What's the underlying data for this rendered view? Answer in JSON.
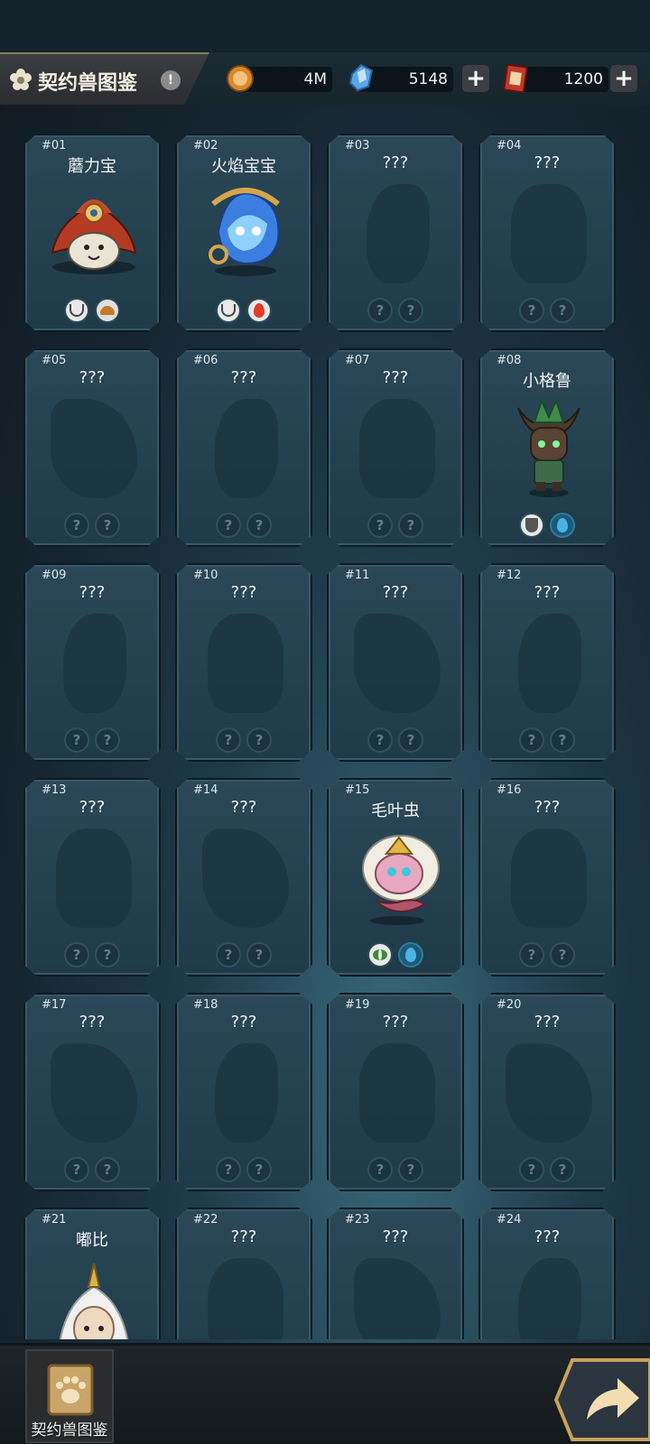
{
  "header": {
    "title": "契约兽图鉴",
    "info": "!",
    "currencies": [
      {
        "name": "coin-icon",
        "value": "4M",
        "plus": false
      },
      {
        "name": "crystal-icon",
        "value": "5148",
        "plus": true
      },
      {
        "name": "ticket-icon",
        "value": "1200",
        "plus": true
      }
    ],
    "plus_label": "+"
  },
  "cards": [
    {
      "num": "#01",
      "name": "蘑力宝",
      "known": true
    },
    {
      "num": "#02",
      "name": "火焰宝宝",
      "known": true
    },
    {
      "num": "#03",
      "name": "???",
      "known": false
    },
    {
      "num": "#04",
      "name": "???",
      "known": false
    },
    {
      "num": "#05",
      "name": "???",
      "known": false
    },
    {
      "num": "#06",
      "name": "???",
      "known": false
    },
    {
      "num": "#07",
      "name": "???",
      "known": false
    },
    {
      "num": "#08",
      "name": "小格鲁",
      "known": true
    },
    {
      "num": "#09",
      "name": "???",
      "known": false
    },
    {
      "num": "#10",
      "name": "???",
      "known": false
    },
    {
      "num": "#11",
      "name": "???",
      "known": false
    },
    {
      "num": "#12",
      "name": "???",
      "known": false
    },
    {
      "num": "#13",
      "name": "???",
      "known": false
    },
    {
      "num": "#14",
      "name": "???",
      "known": false
    },
    {
      "num": "#15",
      "name": "毛叶虫",
      "known": true
    },
    {
      "num": "#16",
      "name": "???",
      "known": false
    },
    {
      "num": "#17",
      "name": "???",
      "known": false
    },
    {
      "num": "#18",
      "name": "???",
      "known": false
    },
    {
      "num": "#19",
      "name": "???",
      "known": false
    },
    {
      "num": "#20",
      "name": "???",
      "known": false
    },
    {
      "num": "#21",
      "name": "嘟比",
      "known": true
    },
    {
      "num": "#22",
      "name": "???",
      "known": false
    },
    {
      "num": "#23",
      "name": "???",
      "known": false
    },
    {
      "num": "#24",
      "name": "???",
      "known": false
    }
  ],
  "unknown_badge": "?",
  "bottom": {
    "book_label": "契约兽图鉴"
  },
  "colors": {
    "card_bg": "#244452",
    "water": "#4ab3e6",
    "fire": "#e23b2a",
    "earth": "#c27a2a"
  }
}
